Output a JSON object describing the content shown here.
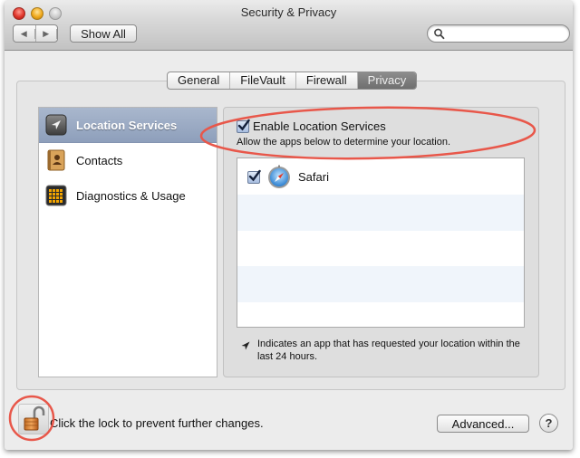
{
  "window": {
    "title": "Security & Privacy"
  },
  "toolbar": {
    "back_icon": "◀",
    "forward_icon": "▶",
    "show_all_label": "Show All",
    "search_placeholder": ""
  },
  "tabs": [
    {
      "label": "General",
      "active": false
    },
    {
      "label": "FileVault",
      "active": false
    },
    {
      "label": "Firewall",
      "active": false
    },
    {
      "label": "Privacy",
      "active": true
    }
  ],
  "sidebar": {
    "items": [
      {
        "label": "Location Services",
        "icon": "location-arrow-icon",
        "selected": true
      },
      {
        "label": "Contacts",
        "icon": "contacts-book-icon",
        "selected": false
      },
      {
        "label": "Diagnostics & Usage",
        "icon": "diagnostics-grid-icon",
        "selected": false
      }
    ]
  },
  "location": {
    "enable_label": "Enable Location Services",
    "enable_checked": true,
    "subtitle": "Allow the apps below to determine your location.",
    "apps": [
      {
        "name": "Safari",
        "checked": true,
        "icon": "safari-compass-icon"
      }
    ],
    "note": "Indicates an app that has requested your location within the last 24 hours."
  },
  "footer": {
    "lock_text": "Click the lock to prevent further changes.",
    "lock_state": "unlocked",
    "advanced_label": "Advanced...",
    "help_label": "?"
  },
  "annotations": {
    "highlight_color": "#e8574a"
  }
}
